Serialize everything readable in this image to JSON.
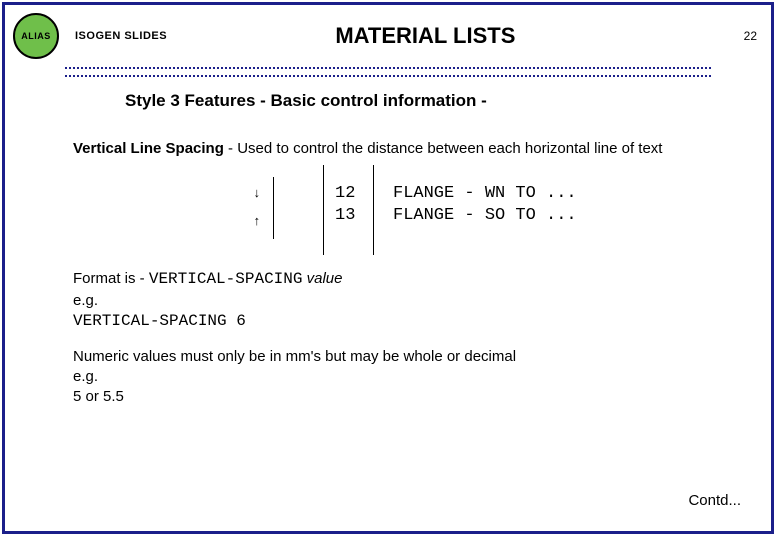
{
  "header": {
    "logo_text": "ALIAS",
    "source": "ISOGEN SLIDES",
    "title": "MATERIAL LISTS",
    "page": "22"
  },
  "subtitle": "Style 3 Features - Basic control information -",
  "section": {
    "lead": "Vertical Line Spacing",
    "lead_rest": " - Used to control the distance between each horizontal line of text"
  },
  "diagram": {
    "n1": "12",
    "n2": "13",
    "t1": "FLANGE - WN TO ...",
    "t2": "FLANGE - SO TO ...",
    "arrow_down": "↓",
    "arrow_up": "↑"
  },
  "format": {
    "label": "Format is - ",
    "keyword": "VERTICAL-SPACING",
    "arg": " value",
    "eg": "e.g.",
    "example": "VERTICAL-SPACING 6"
  },
  "note": {
    "line1": "Numeric values must only be in mm's but may be whole or decimal",
    "line2": "e.g.",
    "line3": "5 or 5.5"
  },
  "contd": "Contd..."
}
